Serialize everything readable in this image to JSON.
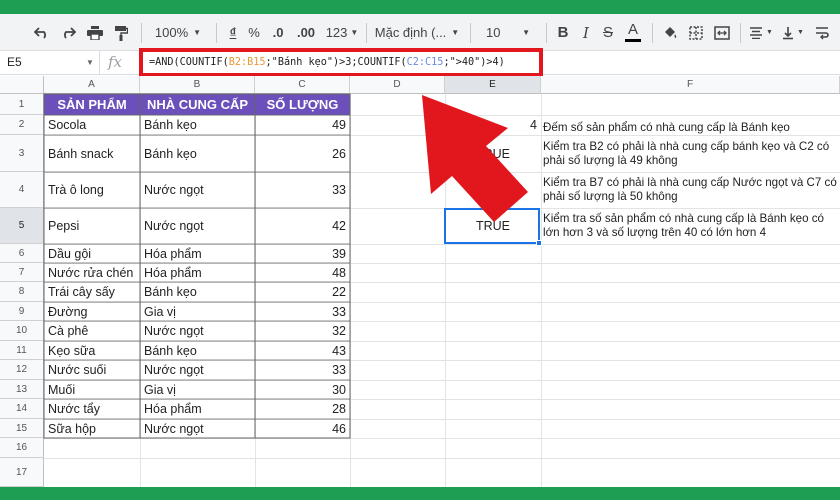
{
  "toolbar": {
    "zoom": "100%",
    "currency": "₫",
    "percent": "%",
    "dec_decrease": ".0",
    "dec_increase": ".00",
    "more_formats": "123",
    "font": "Mặc định (...",
    "font_size": "10",
    "bold": "B",
    "italic": "I",
    "strikethrough": "S",
    "text_color": "A",
    "text_color_hex": "#000000",
    "icons": [
      "undo-icon",
      "redo-icon",
      "print-icon",
      "paint-format-icon",
      "fill-color-icon",
      "borders-icon",
      "merge-icon",
      "align-icon",
      "valign-icon"
    ]
  },
  "formula_bar": {
    "name_box": "E5",
    "fx": "fx",
    "p1": "=AND(COUNTIF(",
    "r1": "B2:B15",
    "p2": ";\"Bánh kẹo\")>3;COUNTIF(",
    "r2": "C2:C15",
    "p3": ";\">40\")>4)"
  },
  "columns": [
    "A",
    "B",
    "C",
    "D",
    "E",
    "F"
  ],
  "rows": [
    "1",
    "2",
    "3",
    "4",
    "5",
    "6",
    "7",
    "8",
    "9",
    "10",
    "11",
    "12",
    "13",
    "14",
    "15",
    "16",
    "17"
  ],
  "headers": {
    "product": "SẢN PHẨM",
    "supplier": "NHÀ CUNG CẤP",
    "quantity": "SỐ LƯỢNG"
  },
  "table": [
    {
      "product": "Socola",
      "supplier": "Bánh kẹo",
      "quantity": "49"
    },
    {
      "product": "Bánh snack",
      "supplier": "Bánh kẹo",
      "quantity": "26"
    },
    {
      "product": "Trà ô long",
      "supplier": "Nước ngọt",
      "quantity": "33"
    },
    {
      "product": "Pepsi",
      "supplier": "Nước ngọt",
      "quantity": "42"
    },
    {
      "product": "Dầu gội",
      "supplier": "Hóa phẩm",
      "quantity": "39"
    },
    {
      "product": "Nước rửa chén",
      "supplier": "Hóa phẩm",
      "quantity": "48"
    },
    {
      "product": "Trái cây sấy",
      "supplier": "Bánh kẹo",
      "quantity": "22"
    },
    {
      "product": "Đường",
      "supplier": "Gia vị",
      "quantity": "33"
    },
    {
      "product": "Cà phê",
      "supplier": "Nước ngọt",
      "quantity": "32"
    },
    {
      "product": "Kẹo sữa",
      "supplier": "Bánh kẹo",
      "quantity": "43"
    },
    {
      "product": "Nước suối",
      "supplier": "Nước ngọt",
      "quantity": "33"
    },
    {
      "product": "Muối",
      "supplier": "Gia vị",
      "quantity": "30"
    },
    {
      "product": "Nước tẩy",
      "supplier": "Hóa phẩm",
      "quantity": "28"
    },
    {
      "product": "Sữa hộp",
      "supplier": "Nước ngọt",
      "quantity": "46"
    }
  ],
  "results": {
    "e2": "4",
    "e3": "TRUE",
    "e4": "SE",
    "e5": "TRUE"
  },
  "notes": {
    "f2": "Đếm số sản phẩm có nhà cung cấp là Bánh kẹo",
    "f3": "Kiểm tra B2 có phải là nhà cung cấp bánh kẹo và C2 có phải số lượng là 49 không",
    "f4": "Kiểm tra B7 có phải là nhà cung cấp Nước ngọt và C7 có phải số lượng là 50 không",
    "f5": "Kiểm tra số sản phẩm có nhà cung cấp là Bánh kẹo có lớn hơn 3 và số lượng trên 40 có lớn hơn 4"
  },
  "colors": {
    "header_fill": "#6b4fbb",
    "highlight_border": "#e2171e",
    "arrow": "#e2171e",
    "selection": "#1a73e8",
    "frame": "#1e9e52"
  }
}
